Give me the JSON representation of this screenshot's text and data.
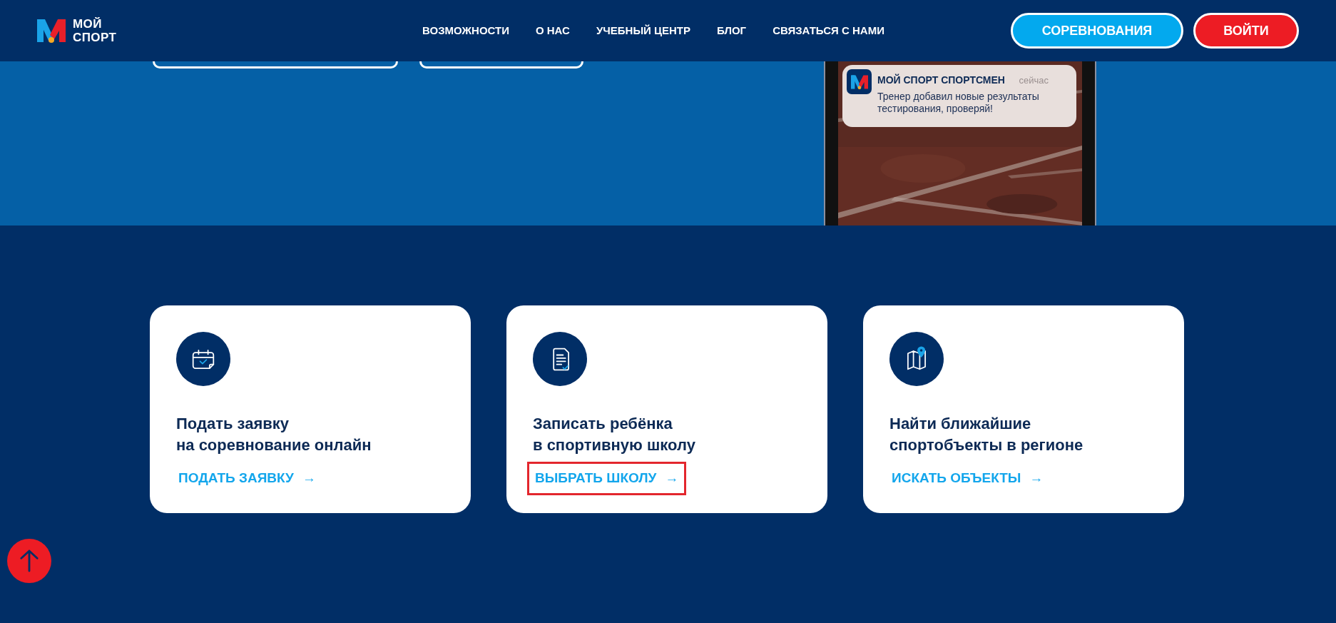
{
  "header": {
    "logo": {
      "lines": [
        "МОЙ",
        "СПОРТ"
      ]
    },
    "nav": [
      {
        "label": "ВОЗМОЖНОСТИ"
      },
      {
        "label": "О НАС"
      },
      {
        "label": "УЧЕБНЫЙ ЦЕНТР"
      },
      {
        "label": "БЛОГ"
      },
      {
        "label": "СВЯЗАТЬСЯ С НАМИ"
      }
    ],
    "buttons": [
      {
        "label": "СОРЕВНОВАНИЯ",
        "kind": "secondary"
      },
      {
        "label": "ВОЙТИ",
        "kind": "primary"
      }
    ]
  },
  "hero": {
    "phone": {
      "notification": {
        "app": "МОЙ СПОРТ СПОРТСМЕН",
        "time": "сейчас",
        "message": "Тренер добавил новые результаты тестирования, проверяй!"
      }
    }
  },
  "cards": [
    {
      "title_lines": [
        "Подать заявку",
        "на соревнование онлайн"
      ],
      "link": "ПОДАТЬ ЗАЯВКУ",
      "arrow": "→",
      "highlighted": false
    },
    {
      "title_lines": [
        "Записать ребёнка",
        "в спортивную школу"
      ],
      "link": "ВЫБРАТЬ ШКОЛУ",
      "arrow": "→",
      "highlighted": true
    },
    {
      "title_lines": [
        "Найти ближайшие",
        "спортобъекты в регионе"
      ],
      "link": "ИСКАТЬ ОБЪЕКТЫ",
      "arrow": "→",
      "highlighted": false
    }
  ]
}
